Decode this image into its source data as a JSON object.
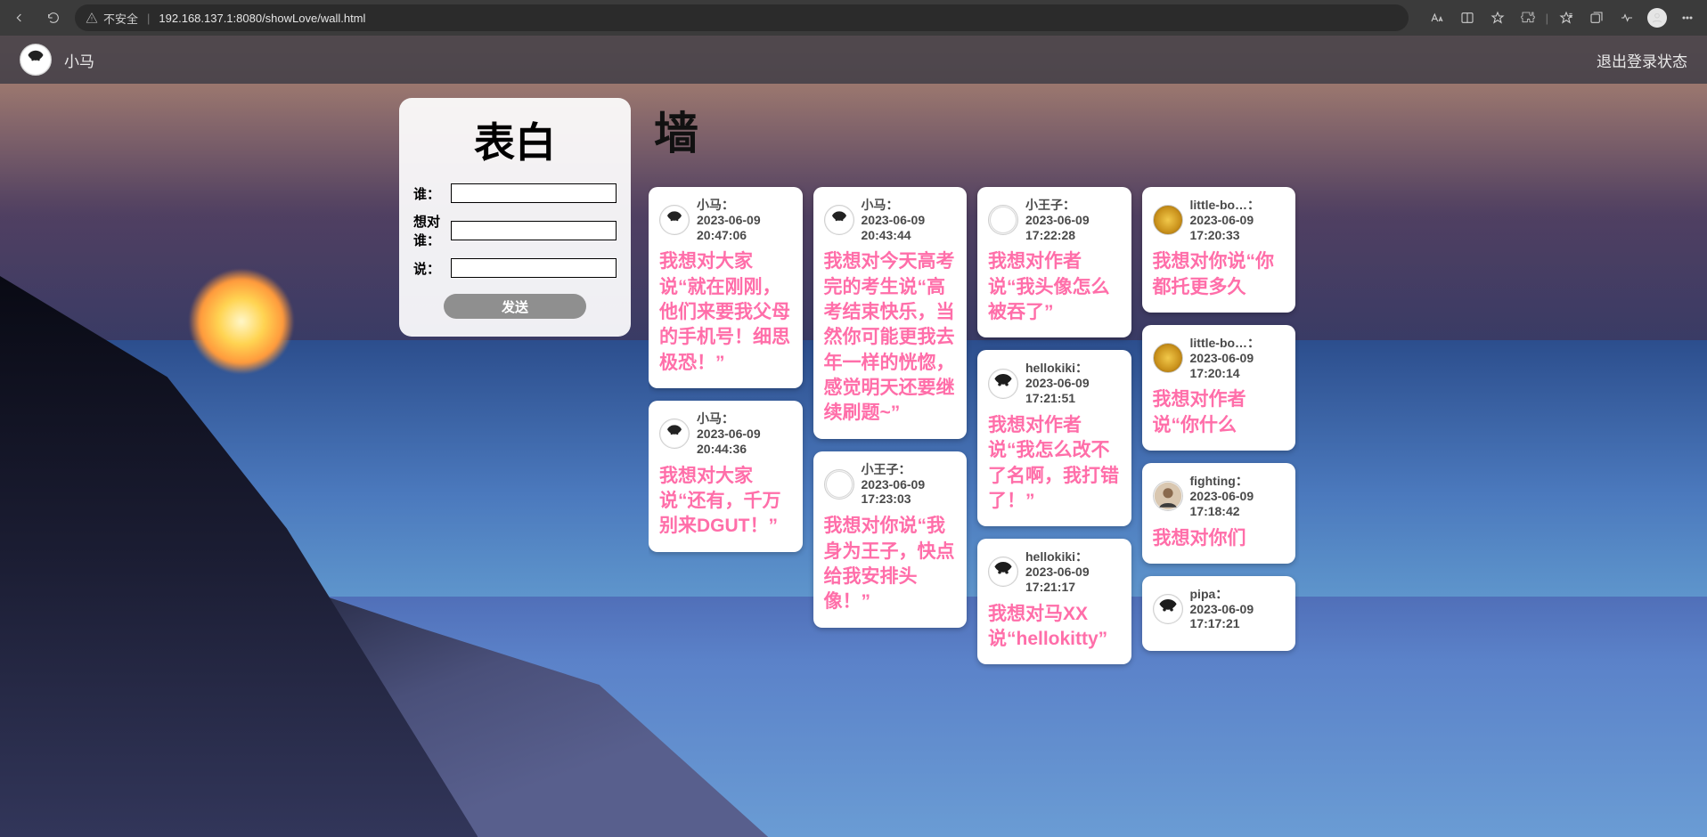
{
  "browser": {
    "insecure_label": "不安全",
    "url": "192.168.137.1:8080/showLove/wall.html"
  },
  "topbar": {
    "username": "小马",
    "logout": "退出登录状态"
  },
  "panel": {
    "title": "表白",
    "label_who": "谁：",
    "label_to": "想对谁：",
    "label_say": "说：",
    "send": "发送"
  },
  "wall": {
    "title": "墙",
    "posts": [
      {
        "avatar": "user",
        "name": "小马",
        "time1": "2023-06-09",
        "time2": "20:47:06",
        "body": "我想对大家说“就在刚刚，他们来要我父母的手机号！细思极恐！”"
      },
      {
        "avatar": "user",
        "name": "小马",
        "time1": "2023-06-09",
        "time2": "20:44:36",
        "body": "我想对大家说“还有，千万别来DGUT！”"
      },
      {
        "avatar": "user",
        "name": "小马",
        "time1": "2023-06-09",
        "time2": "20:43:44",
        "body": "我想对今天高考完的考生说“高考结束快乐，当然你可能更我去年一样的恍惚，感觉明天还要继续刷题~”"
      },
      {
        "avatar": "blank",
        "name": "小王子",
        "time1": "2023-06-09",
        "time2": "17:23:03",
        "body": "我想对你说“我身为王子，快点给我安排头像！”"
      },
      {
        "avatar": "blank",
        "name": "小王子",
        "time1": "2023-06-09",
        "time2": "17:22:28",
        "body": "我想对作者说“我头像怎么被吞了”"
      },
      {
        "avatar": "anime",
        "name": "hellokiki",
        "time1": "2023-06-09",
        "time2": "17:21:51",
        "body": "我想对作者说“我怎么改不了名啊，我打错了！”"
      },
      {
        "avatar": "anime",
        "name": "hellokiki",
        "time1": "2023-06-09",
        "time2": "17:21:17",
        "body": "我想对马XX说“hellokitty”"
      },
      {
        "avatar": "gold",
        "name": "little-bo…",
        "time1": "2023-06-09",
        "time2": "17:20:33",
        "body": "我想对你说“你都托更多久"
      },
      {
        "avatar": "gold",
        "name": "little-bo…",
        "time1": "2023-06-09",
        "time2": "17:20:14",
        "body": "我想对作者说“你什么"
      },
      {
        "avatar": "photo",
        "name": "fighting",
        "time1": "2023-06-09",
        "time2": "17:18:42",
        "body": "我想对你们"
      },
      {
        "avatar": "anime",
        "name": "pipa",
        "time1": "2023-06-09",
        "time2": "17:17:21",
        "body": ""
      }
    ]
  }
}
